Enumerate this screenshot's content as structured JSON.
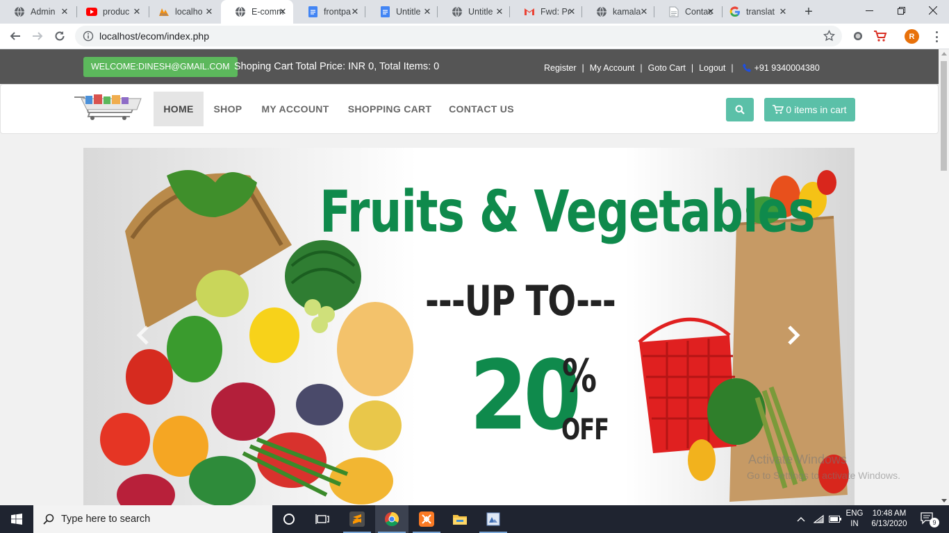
{
  "browser": {
    "tabs": [
      {
        "title": "Admin",
        "icon": "globe-icon",
        "active": false
      },
      {
        "title": "produc",
        "icon": "youtube-icon",
        "active": false
      },
      {
        "title": "localho",
        "icon": "phpmyadmin-icon",
        "active": false
      },
      {
        "title": "E-comm",
        "icon": "globe-icon",
        "active": true
      },
      {
        "title": "frontpa",
        "icon": "docs-icon",
        "active": false
      },
      {
        "title": "Untitle",
        "icon": "docs-icon",
        "active": false
      },
      {
        "title": "Untitle",
        "icon": "globe-icon",
        "active": false
      },
      {
        "title": "Fwd: Pr",
        "icon": "gmail-icon",
        "active": false
      },
      {
        "title": "kamala",
        "icon": "globe-icon",
        "active": false
      },
      {
        "title": "Contac",
        "icon": "document-icon",
        "active": false
      },
      {
        "title": "translat",
        "icon": "google-icon",
        "active": false
      }
    ],
    "url": "localhost/ecom/index.php",
    "profile_initial": "R"
  },
  "topbar": {
    "welcome": "WELCOME:DINESH@GMAIL.COM",
    "cart_summary": "Shoping Cart Total Price: INR 0, Total Items: 0",
    "links": {
      "register": "Register",
      "my_account": "My Account",
      "goto_cart": "Goto Cart",
      "logout": "Logout",
      "separator": "|"
    },
    "phone": "+91 9340004380"
  },
  "nav": {
    "items": [
      {
        "label": "HOME",
        "active": true
      },
      {
        "label": "SHOP",
        "active": false
      },
      {
        "label": "MY ACCOUNT",
        "active": false
      },
      {
        "label": "SHOPPING CART",
        "active": false
      },
      {
        "label": "CONTACT US",
        "active": false
      }
    ],
    "cart_button": "0 items in cart"
  },
  "banner": {
    "headline": "Fruits & Vegetables",
    "upto": "---UP TO---",
    "discount": "20",
    "percent": "%",
    "off": "OFF"
  },
  "watermark": {
    "line1": "Activate Windows",
    "line2": "Go to Settings to activate Windows."
  },
  "taskbar": {
    "search_placeholder": "Type here to search",
    "language": "ENG",
    "region": "IN",
    "time": "10:48 AM",
    "date": "6/13/2020",
    "notification_count": "9"
  },
  "colors": {
    "topbar": "#555555",
    "welcome_badge": "#5cb85c",
    "accent_button": "#5bc0a8",
    "banner_green": "#0f8a4c"
  }
}
